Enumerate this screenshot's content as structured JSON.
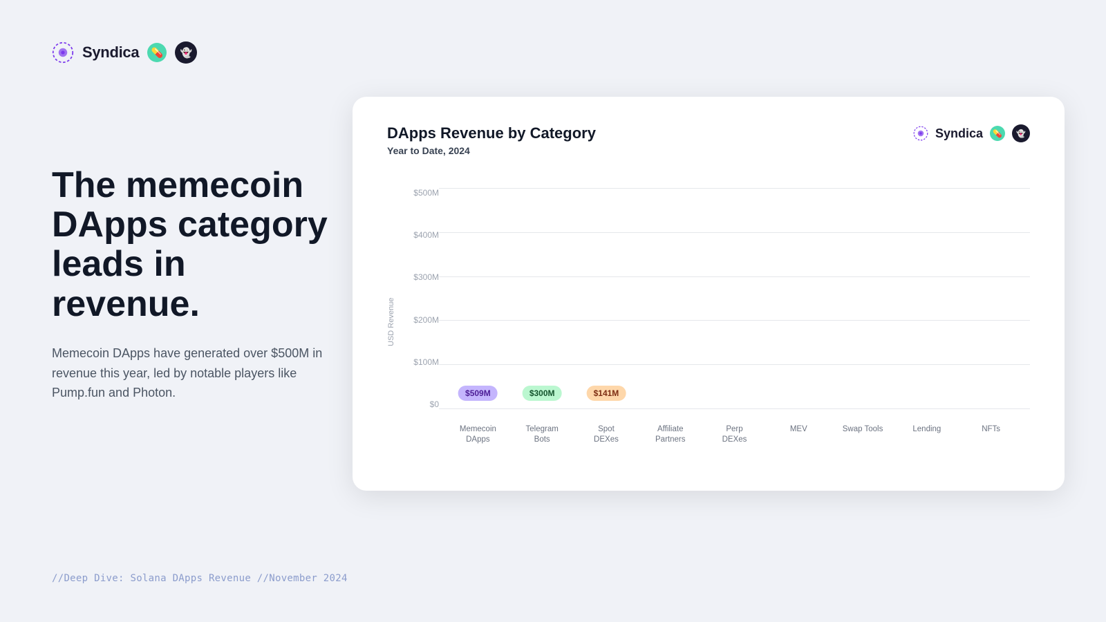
{
  "header": {
    "logo_text": "Syndica"
  },
  "left": {
    "heading": "The memecoin DApps category leads in revenue.",
    "body": "Memecoin DApps have generated over $500M in revenue this year, led by notable players like Pump.fun and Photon."
  },
  "footer": {
    "text": "//Deep Dive: Solana DApps Revenue //November 2024"
  },
  "chart": {
    "title": "DApps Revenue by Category",
    "subtitle": "Year to Date, 2024",
    "y_axis_title": "USD Revenue",
    "y_labels": [
      "$500M",
      "$400M",
      "$300M",
      "$200M",
      "$100M",
      "$0"
    ],
    "bars": [
      {
        "label": "Memecoin\nDApps",
        "value": 509,
        "display": "$509M",
        "color": "#8b5cf6",
        "bubble": "purple",
        "height_pct": 98
      },
      {
        "label": "Telegram\nBots",
        "value": 300,
        "display": "$300M",
        "color": "#84cc16",
        "bubble": "green",
        "height_pct": 58
      },
      {
        "label": "Spot\nDEXes",
        "value": 141,
        "display": "$141M",
        "color": "#f97316",
        "bubble": "orange",
        "height_pct": 27
      },
      {
        "label": "Affiliate\nPartners",
        "value": null,
        "display": null,
        "color": "#22d3ee",
        "bubble": null,
        "height_pct": 23
      },
      {
        "label": "Perp\nDEXes",
        "value": null,
        "display": null,
        "color": "#1e40af",
        "bubble": null,
        "height_pct": 13
      },
      {
        "label": "MEV",
        "value": null,
        "display": null,
        "color": "#ec4899",
        "bubble": null,
        "height_pct": 7
      },
      {
        "label": "Swap Tools",
        "value": null,
        "display": null,
        "color": "#eab308",
        "bubble": null,
        "height_pct": 4
      },
      {
        "label": "Lending",
        "value": null,
        "display": null,
        "color": "#d1b89a",
        "bubble": null,
        "height_pct": 3
      },
      {
        "label": "NFTs",
        "value": null,
        "display": null,
        "color": "#dc2626",
        "bubble": null,
        "height_pct": 2
      }
    ]
  },
  "colors": {
    "background": "#f0f2f7",
    "card": "#ffffff",
    "accent_blue": "#8b9ccc"
  }
}
